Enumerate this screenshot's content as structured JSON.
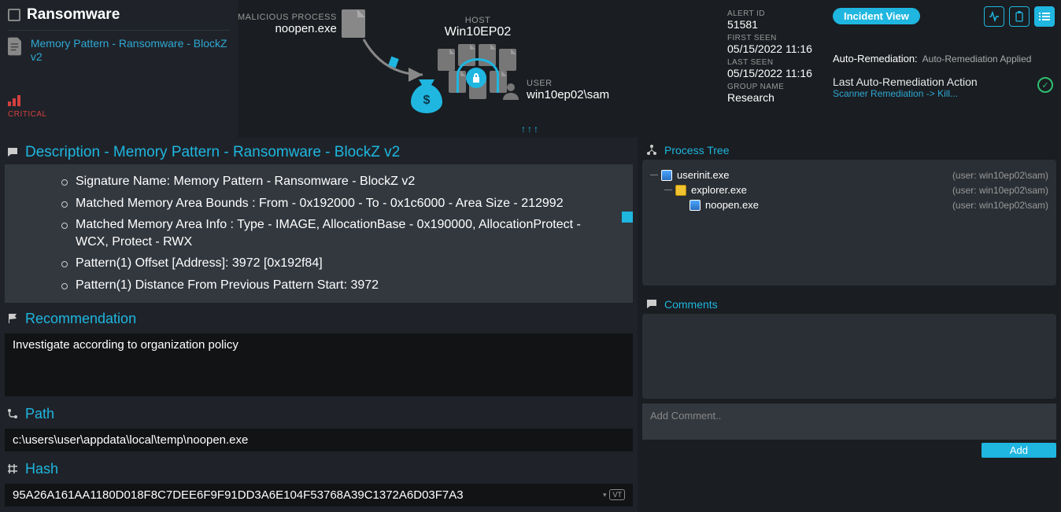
{
  "left": {
    "title": "Ransomware",
    "alert_link": "Memory Pattern - Ransomware - BlockZ v2",
    "critical_label": "CRITICAL"
  },
  "center": {
    "malicious_process_label": "MALICIOUS PROCESS",
    "malicious_process_value": "noopen.exe",
    "host_label": "HOST",
    "host_value": "Win10EP02",
    "user_label": "USER",
    "user_value": "win10ep02\\sam"
  },
  "meta": {
    "alert_id_label": "ALERT ID",
    "alert_id": "51581",
    "first_seen_label": "FIRST SEEN",
    "first_seen": "05/15/2022 11:16",
    "last_seen_label": "LAST SEEN",
    "last_seen": "05/15/2022 11:16",
    "group_label": "GROUP NAME",
    "group": "Research"
  },
  "right": {
    "incident_view": "Incident View",
    "auto_label": "Auto-Remediation:",
    "auto_value": "Auto-Remediation Applied",
    "last_action_label": "Last Auto-Remediation Action",
    "last_action_link": "Scanner Remediation -> Kill..."
  },
  "desc": {
    "heading": "Description - Memory Pattern - Ransomware - BlockZ v2",
    "items": [
      "Signature Name: Memory Pattern - Ransomware - BlockZ v2",
      "Matched Memory Area Bounds : From - 0x192000 - To - 0x1c6000 - Area Size - 212992",
      "Matched Memory Area Info : Type - IMAGE, AllocationBase - 0x190000, AllocationProtect - WCX, Protect - RWX",
      "Pattern(1) Offset [Address]: 3972 [0x192f84]",
      "Pattern(1) Distance From Previous Pattern Start: 3972"
    ]
  },
  "rec": {
    "heading": "Recommendation",
    "text": "Investigate according to organization policy"
  },
  "path": {
    "heading": "Path",
    "value": "c:\\users\\user\\appdata\\local\\temp\\noopen.exe"
  },
  "hash": {
    "heading": "Hash",
    "value": "95A26A161AA1180D018F8C7DEE6F9F91DD3A6E104F53768A39C1372A6D03F7A3"
  },
  "ptree": {
    "heading": "Process Tree",
    "rows": [
      {
        "name": "userinit.exe",
        "user": "(user: win10ep02\\sam)"
      },
      {
        "name": "explorer.exe",
        "user": "(user: win10ep02\\sam)"
      },
      {
        "name": "noopen.exe",
        "user": "(user: win10ep02\\sam)"
      }
    ]
  },
  "comments": {
    "heading": "Comments",
    "placeholder": "Add Comment..",
    "add_button": "Add"
  }
}
